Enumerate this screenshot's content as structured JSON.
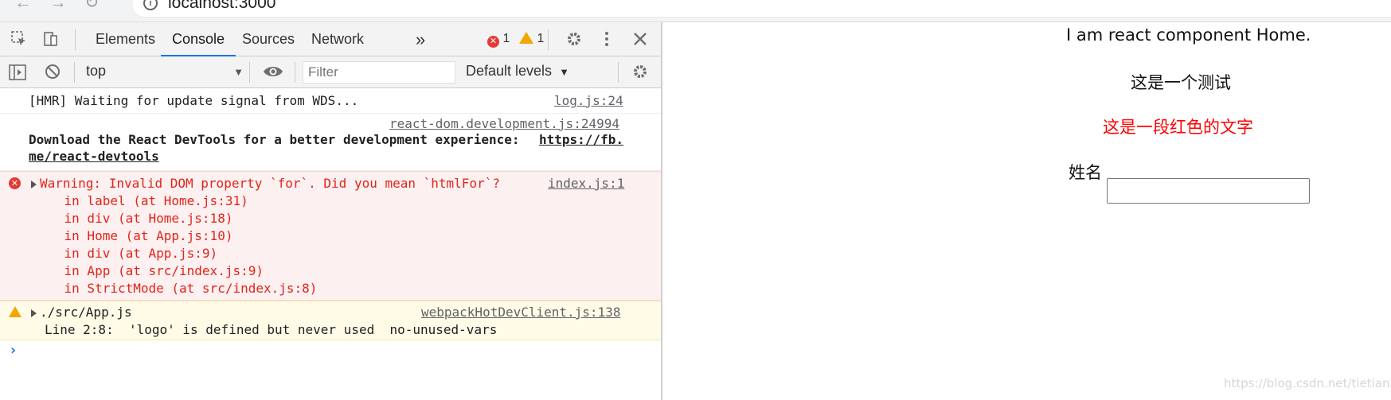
{
  "browser": {
    "address": "localhost:3000",
    "info_icon": "i"
  },
  "devtools": {
    "tabs": [
      "Elements",
      "Console",
      "Sources",
      "Network"
    ],
    "more_tabs": "»",
    "error_count": "1",
    "warning_count": "1",
    "context": "top",
    "filter_placeholder": "Filter",
    "levels_label": "Default levels",
    "messages": [
      {
        "type": "log",
        "lines": [
          "[HMR] Waiting for update signal from WDS..."
        ],
        "source": "log.js:24"
      },
      {
        "type": "log",
        "lines": [
          "Download the React DevTools for a better development experience: ",
          "me/react-devtools"
        ],
        "link_text": "https://fb.",
        "source": "react-dom.development.js:24994"
      },
      {
        "type": "error",
        "lines": [
          "Warning: Invalid DOM property `for`. Did you mean `htmlFor`?",
          "    in label (at Home.js:31)",
          "    in div (at Home.js:18)",
          "    in Home (at App.js:10)",
          "    in div (at App.js:9)",
          "    in App (at src/index.js:9)",
          "    in StrictMode (at src/index.js:8)"
        ],
        "source": "index.js:1"
      },
      {
        "type": "warning",
        "lines": [
          "./src/App.js",
          "Line 2:8:  'logo' is defined but never used  no-unused-vars"
        ],
        "source": "webpackHotDevClient.js:138"
      }
    ],
    "prompt": "›"
  },
  "page": {
    "heading": "I am react component Home.",
    "test_text": "这是一个测试",
    "red_text": "这是一段红色的文字",
    "name_label": "姓名",
    "name_value": "",
    "red_color": "#ff0000",
    "watermark": "https://blog.csdn.net/tietianxl"
  }
}
